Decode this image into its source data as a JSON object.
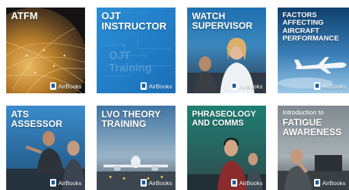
{
  "courses": [
    {
      "title": "ATFM",
      "brand": "AirBooks"
    },
    {
      "title": "OJT\nINSTRUCTOR",
      "brand": "AirBooks"
    },
    {
      "title": "WATCH\nSUPERVISOR",
      "brand": "AirBooks"
    },
    {
      "title": "FACTORS\nAFFECTING\nAIRCRAFT\nPERFORMANCE",
      "brand": "AirBooks"
    },
    {
      "title": "ATS\nASSESSOR",
      "brand": "AirBooks"
    },
    {
      "title": "LVO THEORY\nTRAINING",
      "brand": "AirBooks"
    },
    {
      "title": "PHRASEOLOGY\nAND COMMS",
      "brand": "AirBooks"
    },
    {
      "pretitle": "Introduction to",
      "title": "FATIGUE\nAWARENESS",
      "brand": "AirBooks"
    }
  ],
  "ojt_watermark": "OJT Training"
}
